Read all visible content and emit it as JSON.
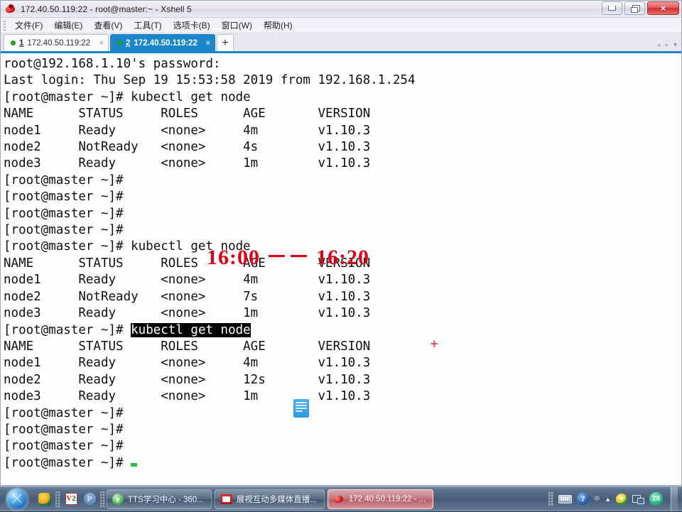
{
  "window": {
    "title": "172.40.50.119:22 - root@master:~ - Xshell 5",
    "app_icon": "xshell-icon",
    "controls": {
      "minimize": "minimize-button",
      "restore": "restore-button",
      "close": "×"
    }
  },
  "menu": {
    "items": [
      {
        "label": "文件(F)",
        "name": "menu-file"
      },
      {
        "label": "编辑(E)",
        "name": "menu-edit"
      },
      {
        "label": "查看(V)",
        "name": "menu-view"
      },
      {
        "label": "工具(T)",
        "name": "menu-tools"
      },
      {
        "label": "选项卡(B)",
        "name": "menu-tabs"
      },
      {
        "label": "窗口(W)",
        "name": "menu-window"
      },
      {
        "label": "帮助(H)",
        "name": "menu-help"
      }
    ]
  },
  "tabs": {
    "items": [
      {
        "num": "1",
        "label": "172.40.50.119:22",
        "active": false,
        "close": "×"
      },
      {
        "num": "2",
        "label": "172.40.50.119:22",
        "active": true,
        "close": "×"
      }
    ],
    "add_label": "+",
    "scroll_left": "◂",
    "scroll_right": "▸",
    "dropdown": "▾",
    "accent_color": "#1b86c9",
    "status_dot_color": "#1faa28"
  },
  "terminal": {
    "background": "#fefdfd",
    "foreground": "#101014",
    "cursor_color": "#22c43a",
    "selection_bg": "#000000",
    "selection_fg": "#ffffff",
    "lines": [
      "root@192.168.1.10's password:",
      "Last login: Thu Sep 19 15:53:58 2019 from 192.168.1.254",
      "[root@master ~]# kubectl get node",
      "NAME      STATUS     ROLES      AGE       VERSION",
      "node1     Ready      <none>     4m        v1.10.3",
      "node2     NotReady   <none>     4s        v1.10.3",
      "node3     Ready      <none>     1m        v1.10.3",
      "[root@master ~]#",
      "[root@master ~]#",
      "[root@master ~]#",
      "[root@master ~]#",
      "[root@master ~]# kubectl get node",
      "NAME      STATUS     ROLES      AGE       VERSION",
      "node1     Ready      <none>     4m        v1.10.3",
      "node2     NotReady   <none>     7s        v1.10.3",
      "node3     Ready      <none>     1m        v1.10.3"
    ],
    "selected_line": {
      "prompt": "[root@master ~]# ",
      "selection": "kubectl get node"
    },
    "lines_after": [
      "NAME      STATUS     ROLES      AGE       VERSION",
      "node1     Ready      <none>     4m        v1.10.3",
      "node2     Ready      <none>     12s       v1.10.3",
      "node3     Ready      <none>     1m        v1.10.3",
      "[root@master ~]#",
      "[root@master ~]#",
      "[root@master ~]#"
    ],
    "last_prompt": "[root@master ~]# "
  },
  "annotations": {
    "time_range": "16:00 －－ 16:20",
    "time_color": "#e00016",
    "plus_marker": "+",
    "plus_color": "#f0394a",
    "paste_icon": "document-lines-icon"
  },
  "taskbar": {
    "start": "start-orb",
    "quick_launch": [
      {
        "name": "360-icon",
        "label": ""
      },
      {
        "name": "v2-icon",
        "label": "V2"
      },
      {
        "name": "p-icon",
        "label": "P"
      }
    ],
    "buttons": [
      {
        "name": "taskbar-item-ie",
        "icon": "ie-icon",
        "label": "TTS学习中心 - 360...",
        "active": false
      },
      {
        "name": "taskbar-item-zhanshi",
        "icon": "tv-icon",
        "label": "展视互动多媒体直播...",
        "active": false
      },
      {
        "name": "taskbar-item-xshell",
        "icon": "xshell-icon",
        "label": "172.40.50.119:22 - ...",
        "active": true
      }
    ],
    "tray": {
      "keyboard": "keyboard-icon",
      "help": "?",
      "ime": "中",
      "overflow": "▲",
      "shield": "security-shield-icon",
      "network": "network-icon",
      "badge_count": "28"
    }
  }
}
